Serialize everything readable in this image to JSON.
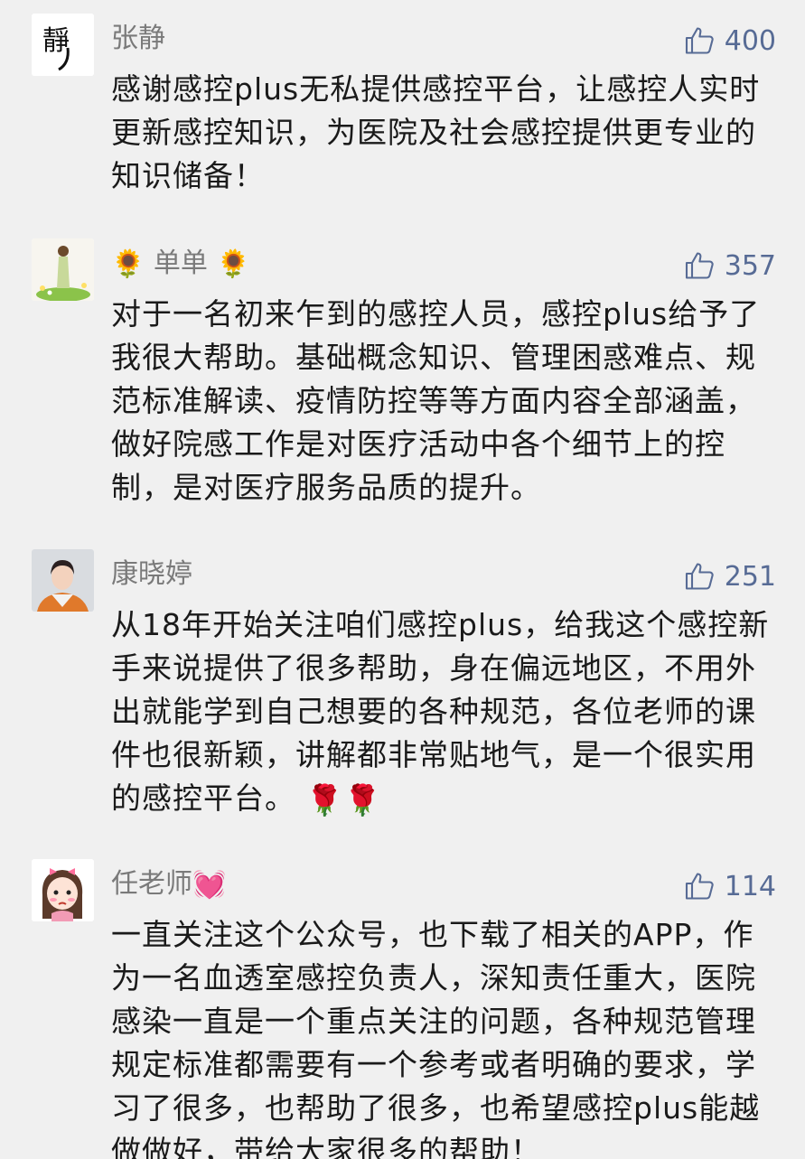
{
  "comments": [
    {
      "name": "张静",
      "likes": "400",
      "text": "感谢感控plus无私提供感控平台，让感控人实时更新感控知识，为医院及社会感控提供更专业的知识储备！",
      "avatar_icon": "calligraphy-jing-avatar"
    },
    {
      "name_prefix_emoji": "🌻",
      "name": "单单",
      "name_suffix_emoji": "🌻",
      "likes": "357",
      "text": "对于一名初来乍到的感控人员，感控plus给予了我很大帮助。基础概念知识、管理困惑难点、规范标准解读、疫情防控等等方面内容全部涵盖，做好院感工作是对医疗活动中各个细节上的控制，是对医疗服务品质的提升。",
      "avatar_icon": "girl-in-field-avatar"
    },
    {
      "name": "康晓婷",
      "likes": "251",
      "text": "从18年开始关注咱们感控plus，给我这个感控新手来说提供了很多帮助，身在偏远地区，不用外出就能学到自己想要的各种规范，各位老师的课件也很新颖，讲解都非常贴地气，是一个很实用的感控平台。",
      "text_suffix_emoji": "🌹🌹",
      "avatar_icon": "woman-photo-avatar"
    },
    {
      "name": "任老师",
      "name_suffix_emoji": "💓",
      "likes": "114",
      "text": "一直关注这个公众号，也下载了相关的APP，作为一名血透室感控负责人，深知责任重大，医院感染一直是一个重点关注的问题，各种规范管理规定标准都需要有一个参考或者明确的要求，学习了很多，也帮助了很多，也希望感控plus能越做做好，带给大家很多的帮助！",
      "avatar_icon": "cartoon-girl-avatar"
    }
  ],
  "colors": {
    "background": "#f0f0f0",
    "name": "#7a7a7a",
    "like": "#576b95",
    "text": "#1a1a1a"
  }
}
